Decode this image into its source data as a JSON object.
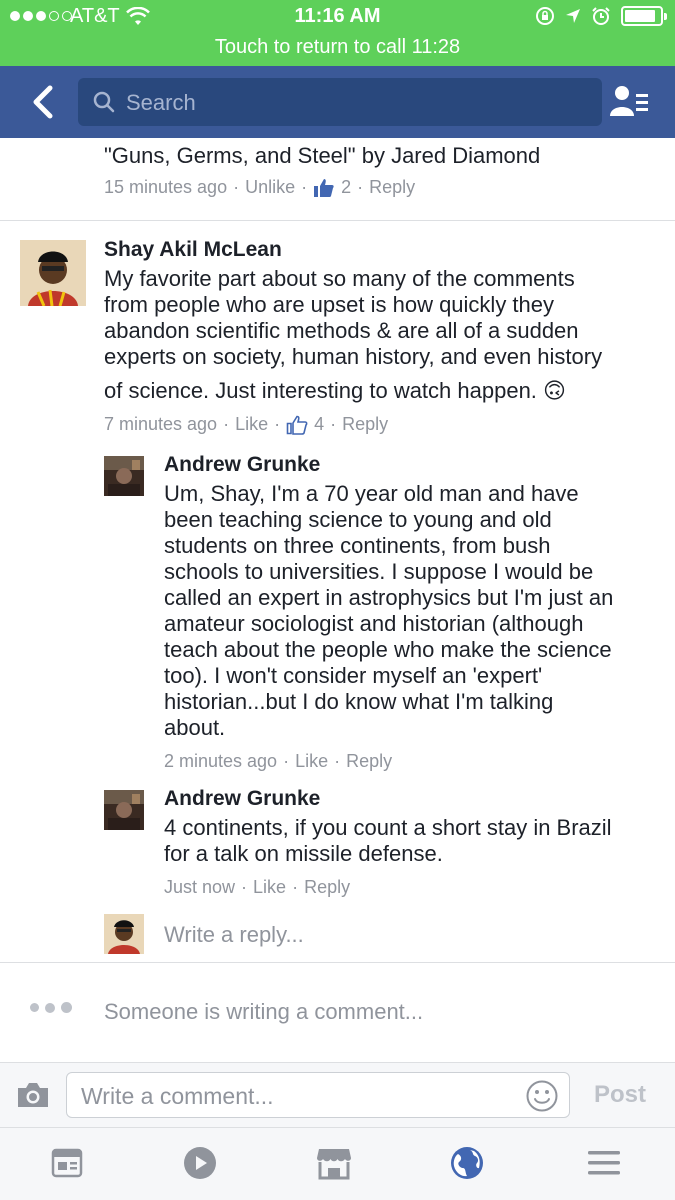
{
  "status": {
    "carrier": "AT&T",
    "time": "11:16 AM",
    "call_banner": "Touch to return to call 11:28"
  },
  "nav": {
    "search_placeholder": "Search"
  },
  "prev_comment": {
    "text": "\"Guns, Germs, and Steel\" by Jared Diamond",
    "time": "15 minutes ago",
    "action": "Unlike",
    "likes": "2",
    "reply": "Reply"
  },
  "comment": {
    "author": "Shay Akil McLean",
    "lines": [
      "My favorite part about so many of the comments",
      "from people who are upset is how quickly they",
      "abandon scientific methods & are all of a sudden",
      "experts on society, human history, and even history",
      "of science. Just interesting to watch happen. 🙃"
    ],
    "time": "7 minutes ago",
    "action": "Like",
    "likes": "4",
    "reply": "Reply"
  },
  "replies": [
    {
      "author": "Andrew Grunke",
      "lines": [
        "Um, Shay, I'm a 70 year old man and have",
        "been teaching science to young and old",
        "students on three continents, from bush",
        "schools to universities.  I suppose I would be",
        "called an expert in astrophysics but I'm just an",
        "amateur sociologist and historian (although",
        "teach about the people who make the science",
        "too).  I won't consider myself an 'expert'",
        "historian...but I do know what I'm talking",
        "about."
      ],
      "time": "2 minutes ago",
      "action": "Like",
      "reply": "Reply"
    },
    {
      "author": "Andrew Grunke",
      "lines": [
        "4 continents, if you count a short stay in Brazil",
        "for a talk on missile defense."
      ],
      "time": "Just now",
      "action": "Like",
      "reply": "Reply"
    }
  ],
  "write_reply_placeholder": "Write a reply...",
  "typing_indicator": "Someone is writing a comment...",
  "composer": {
    "placeholder": "Write a comment...",
    "post_label": "Post"
  },
  "colors": {
    "facebook_blue": "#3b5998",
    "call_green": "#5ed05a",
    "meta_gray": "#90949c"
  }
}
